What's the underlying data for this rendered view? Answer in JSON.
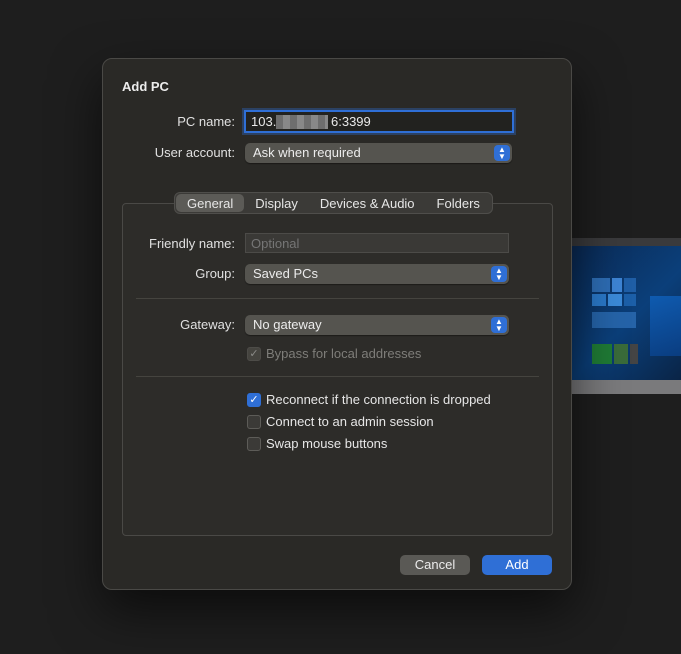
{
  "dialog": {
    "title": "Add PC"
  },
  "pc_name": {
    "label": "PC name:",
    "value_prefix": "103.",
    "value_suffix": "6:3399"
  },
  "user_account": {
    "label": "User account:",
    "value": "Ask when required"
  },
  "tabs": [
    "General",
    "Display",
    "Devices & Audio",
    "Folders"
  ],
  "general": {
    "friendly_name": {
      "label": "Friendly name:",
      "placeholder": "Optional"
    },
    "group": {
      "label": "Group:",
      "value": "Saved PCs"
    },
    "gateway": {
      "label": "Gateway:",
      "value": "No gateway"
    },
    "bypass": {
      "label": "Bypass for local addresses",
      "checked": true,
      "disabled": true
    },
    "options": [
      {
        "label": "Reconnect if the connection is dropped",
        "checked": true
      },
      {
        "label": "Connect to an admin session",
        "checked": false
      },
      {
        "label": "Swap mouse buttons",
        "checked": false
      }
    ]
  },
  "buttons": {
    "cancel": "Cancel",
    "add": "Add"
  },
  "colors": {
    "accent": "#2f6fd6",
    "dialog_bg": "#2a2926",
    "page_bg": "#1e1e1e"
  }
}
